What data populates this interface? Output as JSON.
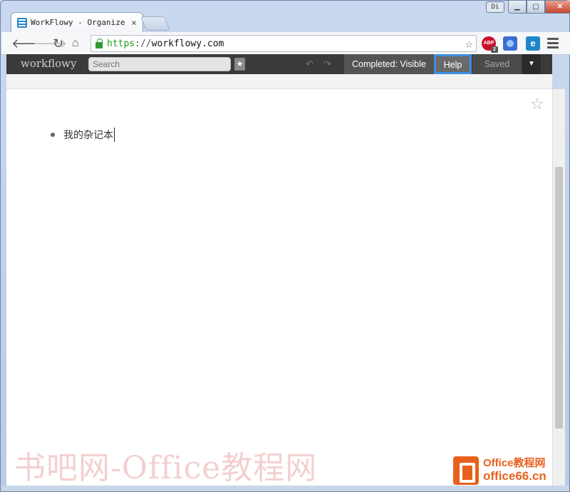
{
  "browser": {
    "tab_title": "WorkFlowy - Organize yo",
    "tab_close": "×",
    "profile_badge": "Di",
    "url_scheme": "https",
    "url_sep": "://",
    "url_host": "workflowy.com",
    "extensions": [
      "ABP",
      "2",
      "e"
    ]
  },
  "app": {
    "logo": "workflowy",
    "search_placeholder": "Search",
    "star_label": "★",
    "completed_label": "Completed: Visible",
    "help_label": "Help",
    "saved_label": "Saved",
    "dropdown_label": "▼"
  },
  "outline": {
    "items": [
      {
        "text": "我的杂记本"
      }
    ]
  },
  "watermarks": {
    "left": "书吧网-Office教程网",
    "right_line1": "Office教程网",
    "right_line2": "office66.cn"
  },
  "colors": {
    "accent_help_border": "#3b8fe0",
    "appbar_bg": "#3a3a3a",
    "url_green": "#1f9b1f",
    "watermark_orange": "#e8611c"
  }
}
